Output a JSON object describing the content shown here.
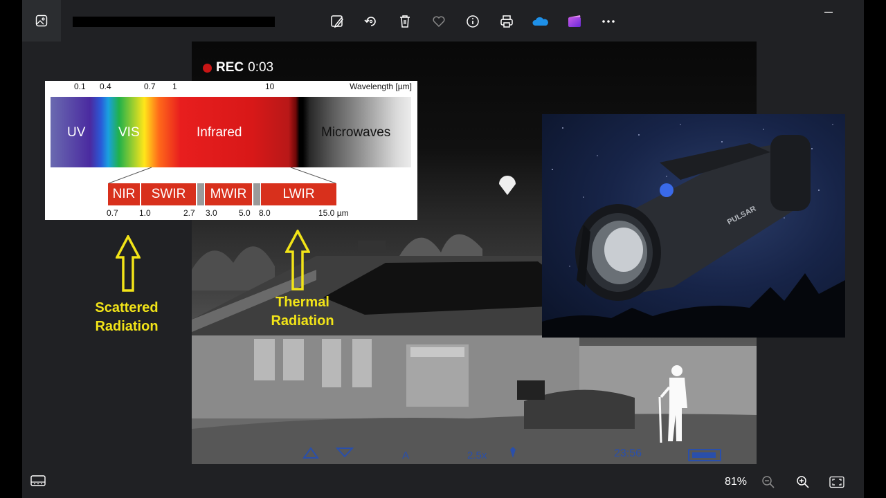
{
  "titlebar": {
    "gallery_icon": "gallery-icon",
    "toolbar": [
      {
        "name": "edit-image-icon",
        "label": "Edit image"
      },
      {
        "name": "rotate-icon",
        "label": "Rotate"
      },
      {
        "name": "delete-icon",
        "label": "Delete"
      },
      {
        "name": "favorite-icon",
        "label": "Favorite"
      },
      {
        "name": "info-icon",
        "label": "File info"
      },
      {
        "name": "print-icon",
        "label": "Print"
      },
      {
        "name": "onedrive-icon",
        "label": "OneDrive"
      },
      {
        "name": "clipchamp-icon",
        "label": "Clipchamp"
      },
      {
        "name": "more-icon",
        "label": "See more"
      }
    ],
    "minimize_icon": "minimize-icon"
  },
  "image": {
    "rec_label": "REC",
    "rec_time": "0:03",
    "hud_time": "23:56",
    "spectrum": {
      "top_ticks": [
        "0.1",
        "0.4",
        "0.7",
        "1",
        "10"
      ],
      "wavelength_label": "Wavelength [µm]",
      "regions": [
        "UV",
        "VIS",
        "Infrared",
        "Microwaves"
      ],
      "bands": [
        "NIR",
        "SWIR",
        "MWIR",
        "LWIR"
      ],
      "band_ticks": [
        "0.7",
        "1.0",
        "2.7",
        "3.0",
        "5.0",
        "8.0",
        "15.0 µm"
      ]
    },
    "arrow_left_caption": [
      "Scattered",
      "Radiation"
    ],
    "arrow_right_caption": [
      "Thermal",
      "Radiation"
    ],
    "product_brand": "PULSAR"
  },
  "statusbar": {
    "zoom": "81%",
    "filmstrip_icon": "filmstrip-icon",
    "zoom_out_icon": "zoom-out-icon",
    "zoom_in_icon": "zoom-in-icon",
    "fit_icon": "fit-to-window-icon"
  },
  "colors": {
    "background": "#202124",
    "spectrum_band": "#d8301c",
    "annotation_yellow": "#f2e418",
    "hud_blue": "#2a4faa"
  }
}
